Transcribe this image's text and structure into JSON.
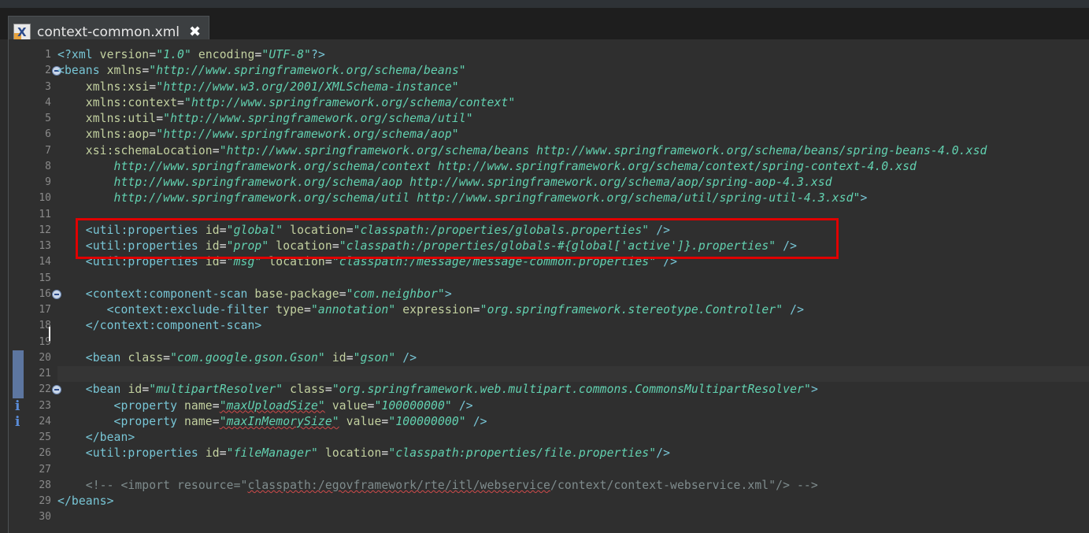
{
  "tab": {
    "title": "context-common.xml",
    "file_icon": "xml-file-icon",
    "close_icon": "close-icon"
  },
  "colors": {
    "tag": "#78c6d6",
    "attr": "#c3d1a0",
    "value": "#62d1b0",
    "comment": "#7f8c8d",
    "highlight": "#e00000"
  },
  "line_numbers": [
    "1",
    "2",
    "3",
    "4",
    "5",
    "6",
    "7",
    "8",
    "9",
    "10",
    "11",
    "12",
    "13",
    "14",
    "15",
    "16",
    "17",
    "18",
    "19",
    "20",
    "21",
    "22",
    "23",
    "24",
    "25",
    "26",
    "27",
    "28",
    "29",
    "30"
  ],
  "lines": [
    [
      [
        "pi",
        "<?xml "
      ],
      [
        "attr",
        "version"
      ],
      [
        "txt",
        "="
      ],
      [
        "val",
        "\"1.0\""
      ],
      [
        "txt",
        " "
      ],
      [
        "attr",
        "encoding"
      ],
      [
        "txt",
        "="
      ],
      [
        "val",
        "\"UTF-8\""
      ],
      [
        "pi",
        "?>"
      ]
    ],
    [
      [
        "tag",
        "<beans "
      ],
      [
        "attr",
        "xmlns"
      ],
      [
        "txt",
        "="
      ],
      [
        "val",
        "\"http://www.springframework.org/schema/beans\""
      ]
    ],
    [
      [
        "txt",
        "    "
      ],
      [
        "attr",
        "xmlns:xsi"
      ],
      [
        "txt",
        "="
      ],
      [
        "val",
        "\"http://www.w3.org/2001/XMLSchema-instance\""
      ]
    ],
    [
      [
        "txt",
        "    "
      ],
      [
        "attr",
        "xmlns:context"
      ],
      [
        "txt",
        "="
      ],
      [
        "val",
        "\"http://www.springframework.org/schema/context\""
      ]
    ],
    [
      [
        "txt",
        "    "
      ],
      [
        "attr",
        "xmlns:util"
      ],
      [
        "txt",
        "="
      ],
      [
        "val",
        "\"http://www.springframework.org/schema/util\""
      ]
    ],
    [
      [
        "txt",
        "    "
      ],
      [
        "attr",
        "xmlns:aop"
      ],
      [
        "txt",
        "="
      ],
      [
        "val",
        "\"http://www.springframework.org/schema/aop\""
      ]
    ],
    [
      [
        "txt",
        "    "
      ],
      [
        "attr",
        "xsi:schemaLocation"
      ],
      [
        "txt",
        "="
      ],
      [
        "val",
        "\"http://www.springframework.org/schema/beans http://www.springframework.org/schema/beans/spring-beans-4.0.xsd"
      ]
    ],
    [
      [
        "val",
        "        http://www.springframework.org/schema/context http://www.springframework.org/schema/context/spring-context-4.0.xsd"
      ]
    ],
    [
      [
        "val",
        "        http://www.springframework.org/schema/aop http://www.springframework.org/schema/aop/spring-aop-4.3.xsd"
      ]
    ],
    [
      [
        "val",
        "        http://www.springframework.org/schema/util http://www.springframework.org/schema/util/spring-util-4.3.xsd\""
      ],
      [
        "tag",
        ">"
      ]
    ],
    [],
    [
      [
        "txt",
        "    "
      ],
      [
        "tag",
        "<util:properties "
      ],
      [
        "attr",
        "id"
      ],
      [
        "txt",
        "="
      ],
      [
        "val",
        "\"global\""
      ],
      [
        "txt",
        " "
      ],
      [
        "attr",
        "location"
      ],
      [
        "txt",
        "="
      ],
      [
        "val",
        "\"classpath:/properties/globals.properties\""
      ],
      [
        "txt",
        " "
      ],
      [
        "tag",
        "/>"
      ]
    ],
    [
      [
        "txt",
        "    "
      ],
      [
        "tag",
        "<util:properties "
      ],
      [
        "attr",
        "id"
      ],
      [
        "txt",
        "="
      ],
      [
        "val",
        "\"prop\""
      ],
      [
        "txt",
        " "
      ],
      [
        "attr",
        "location"
      ],
      [
        "txt",
        "="
      ],
      [
        "val",
        "\"classpath:/properties/globals-#{global['active']}.properties\""
      ],
      [
        "txt",
        " "
      ],
      [
        "tag",
        "/>"
      ]
    ],
    [
      [
        "txt",
        "    "
      ],
      [
        "tag",
        "<util:properties "
      ],
      [
        "attr",
        "id"
      ],
      [
        "txt",
        "="
      ],
      [
        "val",
        "\"msg\""
      ],
      [
        "txt",
        " "
      ],
      [
        "attr",
        "location"
      ],
      [
        "txt",
        "="
      ],
      [
        "val",
        "\"classpath:/message/message-common.properties\""
      ],
      [
        "txt",
        " "
      ],
      [
        "tag",
        "/>"
      ]
    ],
    [],
    [
      [
        "txt",
        "    "
      ],
      [
        "tag",
        "<context:component-scan "
      ],
      [
        "attr",
        "base-package"
      ],
      [
        "txt",
        "="
      ],
      [
        "val",
        "\"com.neighbor\""
      ],
      [
        "tag",
        ">"
      ]
    ],
    [
      [
        "txt",
        "       "
      ],
      [
        "tag",
        "<context:exclude-filter "
      ],
      [
        "attr",
        "type"
      ],
      [
        "txt",
        "="
      ],
      [
        "val",
        "\"annotation\""
      ],
      [
        "txt",
        " "
      ],
      [
        "attr",
        "expression"
      ],
      [
        "txt",
        "="
      ],
      [
        "val",
        "\"org.springframework.stereotype.Controller\""
      ],
      [
        "txt",
        " "
      ],
      [
        "tag",
        "/>"
      ]
    ],
    [
      [
        "txt",
        "    "
      ],
      [
        "tag",
        "</context:component-scan>"
      ]
    ],
    [],
    [
      [
        "txt",
        "    "
      ],
      [
        "tag",
        "<bean "
      ],
      [
        "attr",
        "class"
      ],
      [
        "txt",
        "="
      ],
      [
        "val",
        "\"com.google.gson.Gson\""
      ],
      [
        "txt",
        " "
      ],
      [
        "attr",
        "id"
      ],
      [
        "txt",
        "="
      ],
      [
        "val",
        "\"gson\""
      ],
      [
        "txt",
        " "
      ],
      [
        "tag",
        "/>"
      ]
    ],
    [],
    [
      [
        "txt",
        "    "
      ],
      [
        "tag",
        "<bean "
      ],
      [
        "attr",
        "id"
      ],
      [
        "txt",
        "="
      ],
      [
        "val",
        "\"multipartResolver\""
      ],
      [
        "txt",
        " "
      ],
      [
        "attr",
        "class"
      ],
      [
        "txt",
        "="
      ],
      [
        "val",
        "\"org.springframework.web.multipart.commons.CommonsMultipartResolver\""
      ],
      [
        "tag",
        ">"
      ]
    ],
    [
      [
        "txt",
        "        "
      ],
      [
        "tag",
        "<property "
      ],
      [
        "attr",
        "name"
      ],
      [
        "txt",
        "="
      ],
      [
        "valsq",
        "\"maxUploadSize\""
      ],
      [
        "txt",
        " "
      ],
      [
        "attr",
        "value"
      ],
      [
        "txt",
        "="
      ],
      [
        "val",
        "\"100000000\""
      ],
      [
        "txt",
        " "
      ],
      [
        "tag",
        "/>"
      ]
    ],
    [
      [
        "txt",
        "        "
      ],
      [
        "tag",
        "<property "
      ],
      [
        "attr",
        "name"
      ],
      [
        "txt",
        "="
      ],
      [
        "valsq",
        "\"maxInMemorySize\""
      ],
      [
        "txt",
        " "
      ],
      [
        "attr",
        "value"
      ],
      [
        "txt",
        "="
      ],
      [
        "val",
        "\"100000000\""
      ],
      [
        "txt",
        " "
      ],
      [
        "tag",
        "/>"
      ]
    ],
    [
      [
        "txt",
        "    "
      ],
      [
        "tag",
        "</bean>"
      ]
    ],
    [
      [
        "txt",
        "    "
      ],
      [
        "tag",
        "<util:properties "
      ],
      [
        "attr",
        "id"
      ],
      [
        "txt",
        "="
      ],
      [
        "val",
        "\"fileManager\""
      ],
      [
        "txt",
        " "
      ],
      [
        "attr",
        "location"
      ],
      [
        "txt",
        "="
      ],
      [
        "val",
        "\"classpath:properties/file.properties\""
      ],
      [
        "tag",
        "/>"
      ]
    ],
    [],
    [
      [
        "comment",
        "    <!-- <import resource=\""
      ],
      [
        "commentsq",
        "classpath:/egovframework/rte/itl/webservice"
      ],
      [
        "comment",
        "/context/context-webservice.xml\"/> -->"
      ]
    ],
    [
      [
        "tag",
        "</beans>"
      ]
    ],
    []
  ],
  "fold_lines": [
    2,
    16,
    22
  ],
  "marker_lines": [
    20,
    21,
    22
  ],
  "info_lines": [
    23,
    24
  ],
  "current_line": 21
}
